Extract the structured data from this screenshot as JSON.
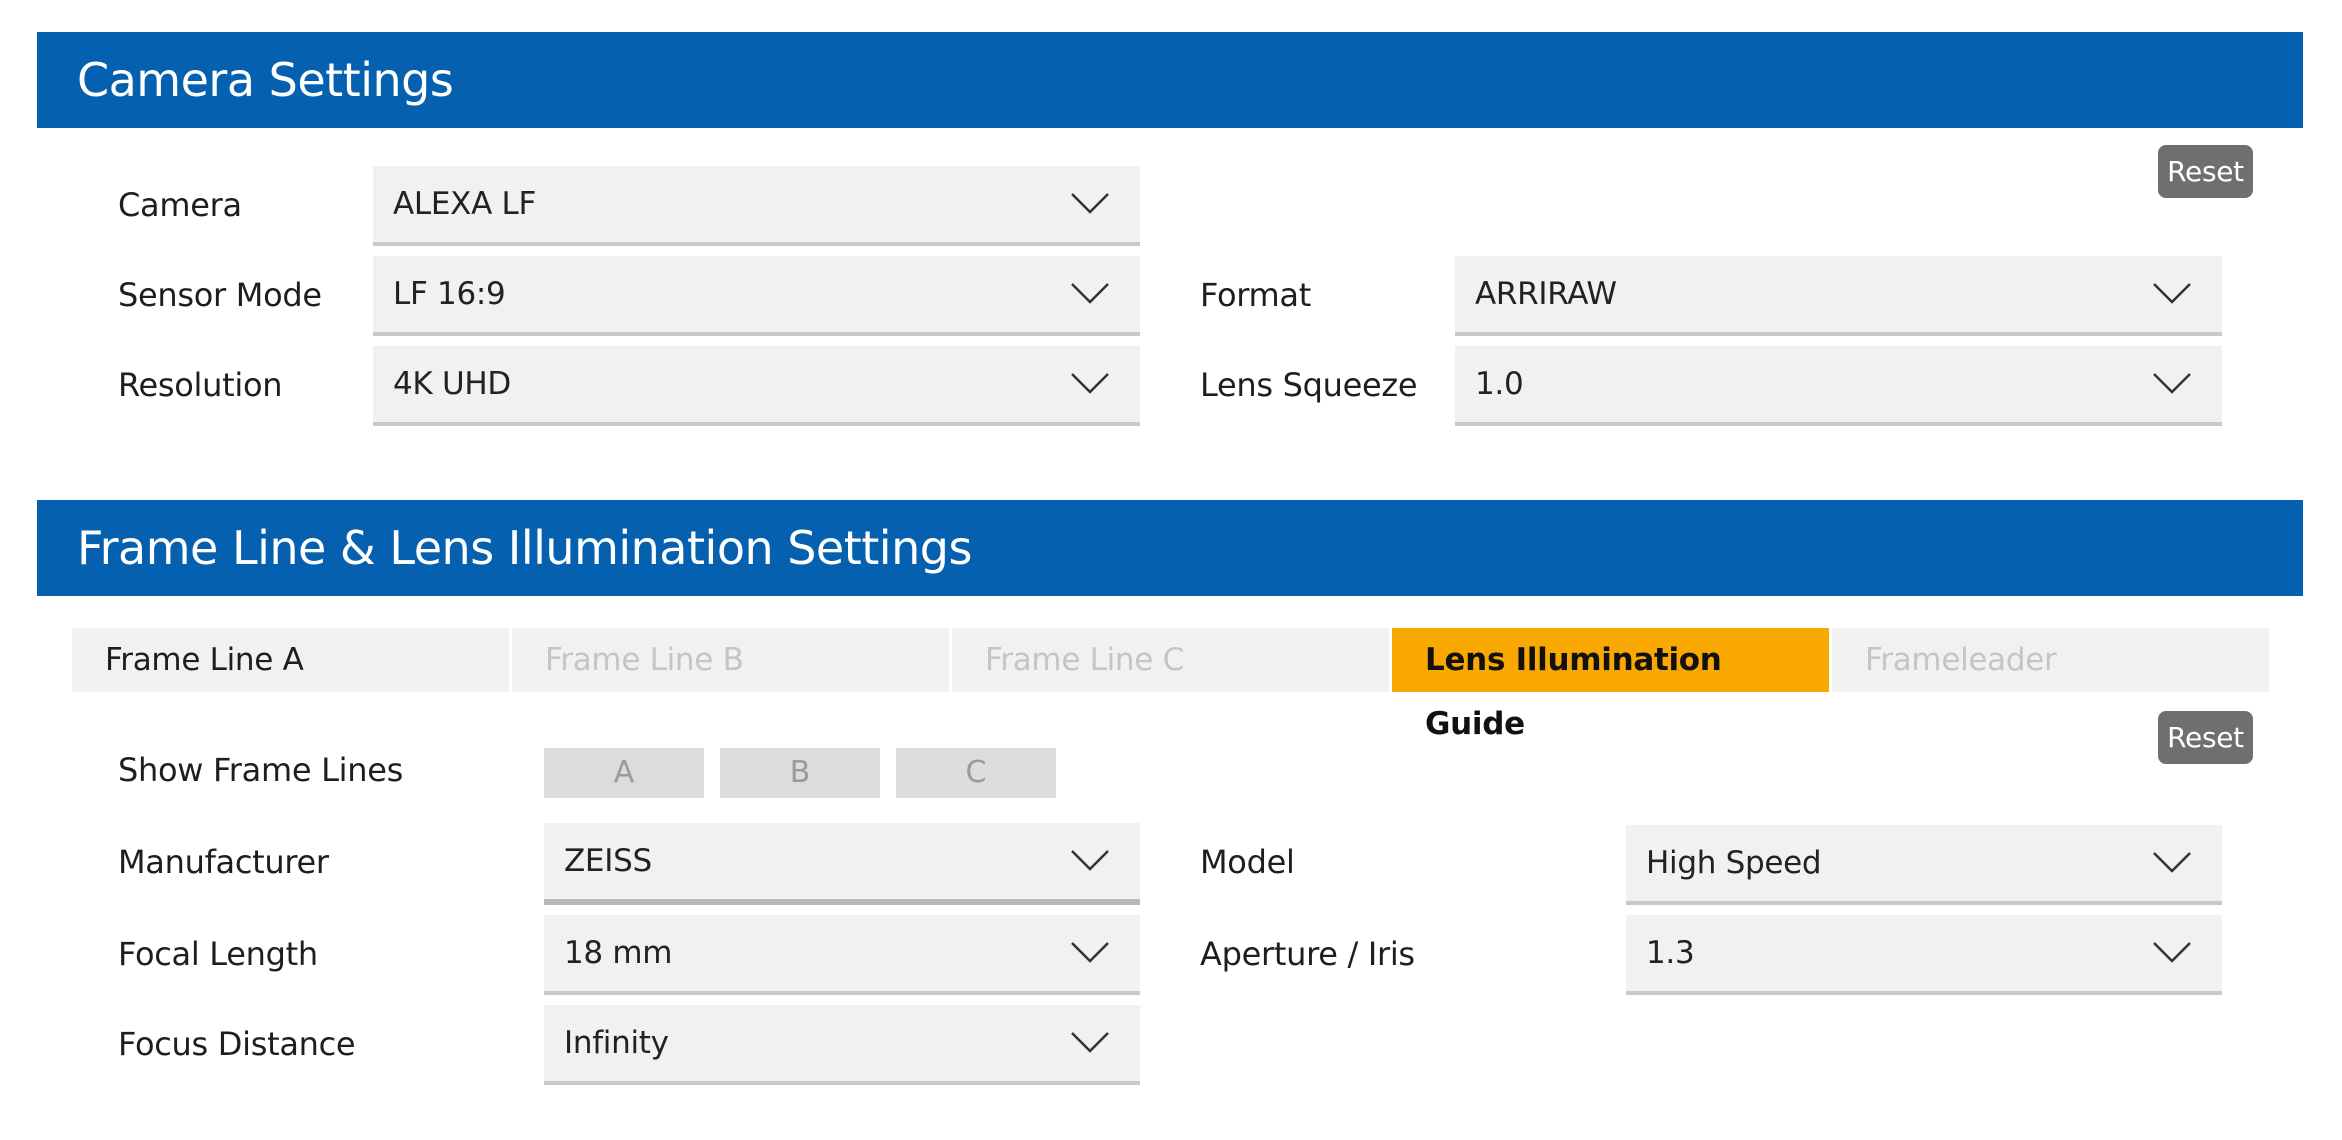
{
  "camera_settings": {
    "title": "Camera Settings",
    "reset_label": "Reset",
    "fields": {
      "camera": {
        "label": "Camera",
        "value": "ALEXA LF"
      },
      "sensor_mode": {
        "label": "Sensor Mode",
        "value": "LF 16:9"
      },
      "resolution": {
        "label": "Resolution",
        "value": "4K UHD"
      },
      "format": {
        "label": "Format",
        "value": "ARRIRAW"
      },
      "lens_squeeze": {
        "label": "Lens Squeeze",
        "value": "1.0"
      }
    }
  },
  "frame_settings": {
    "title": "Frame Line & Lens Illumination Settings",
    "reset_label": "Reset",
    "tabs": [
      {
        "label": "Frame Line A"
      },
      {
        "label": "Frame Line B"
      },
      {
        "label": "Frame Line C"
      },
      {
        "label": "Lens Illumination Guide",
        "active": true
      },
      {
        "label": "Frameleader"
      }
    ],
    "show_frame_lines": {
      "label": "Show Frame Lines",
      "options": [
        "A",
        "B",
        "C"
      ]
    },
    "fields": {
      "manufacturer": {
        "label": "Manufacturer",
        "value": "ZEISS"
      },
      "focal_length": {
        "label": "Focal Length",
        "value": "18 mm"
      },
      "focus_distance": {
        "label": "Focus Distance",
        "value": "Infinity"
      },
      "model": {
        "label": "Model",
        "value": "High Speed"
      },
      "aperture": {
        "label": "Aperture / Iris",
        "value": "1.3"
      }
    }
  },
  "colors": {
    "header_blue": "#0561b0",
    "active_tab": "#f8a800",
    "reset_button": "#6f6f6f"
  },
  "icons": {
    "dropdown": "chevron-down-icon"
  }
}
